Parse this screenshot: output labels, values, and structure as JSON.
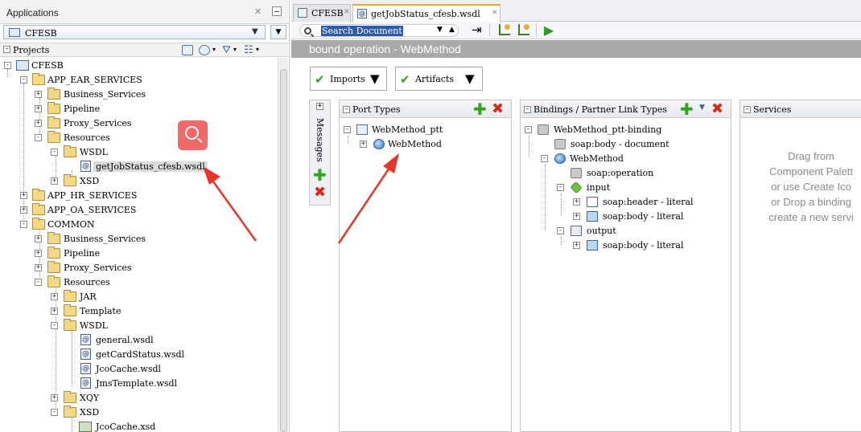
{
  "applications": {
    "title": "Applications",
    "selected_app": "CFESB",
    "projects_label": "Projects"
  },
  "tree": [
    {
      "label": "CFESB"
    },
    {
      "label": "APP_EAR_SERVICES"
    },
    {
      "label": "Business_Services"
    },
    {
      "label": "Pipeline"
    },
    {
      "label": "Proxy_Services"
    },
    {
      "label": "Resources"
    },
    {
      "label": "WSDL"
    },
    {
      "label": "getJobStatus_cfesb.wsdl"
    },
    {
      "label": "XSD"
    },
    {
      "label": "APP_HR_SERVICES"
    },
    {
      "label": "APP_OA_SERVICES"
    },
    {
      "label": "COMMON"
    },
    {
      "label": "Business_Services"
    },
    {
      "label": "Pipeline"
    },
    {
      "label": "Proxy_Services"
    },
    {
      "label": "Resources"
    },
    {
      "label": "JAR"
    },
    {
      "label": "Template"
    },
    {
      "label": "WSDL"
    },
    {
      "label": "general.wsdl"
    },
    {
      "label": "getCardStatus.wsdl"
    },
    {
      "label": "JcoCache.wsdl"
    },
    {
      "label": "JmsTemplate.wsdl"
    },
    {
      "label": "XQY"
    },
    {
      "label": "XSD"
    },
    {
      "label": "JcoCache.xsd"
    }
  ],
  "editor_tabs": [
    {
      "label": "CFESB"
    },
    {
      "label": "getJobStatus_cfesb.wsdl"
    }
  ],
  "search": {
    "text": "Search Document"
  },
  "ops_header": "bound operation - WebMethod",
  "buttons": {
    "imports": "Imports",
    "artifacts": "Artifacts"
  },
  "messages_label": "Messages",
  "port_types": {
    "title": "Port Types",
    "items": [
      "WebMethod_ptt",
      "WebMethod"
    ]
  },
  "bindings": {
    "title": "Bindings / Partner Link Types",
    "items": [
      "WebMethod_ptt-binding",
      "soap:body - document",
      "WebMethod",
      "soap:operation",
      "input",
      "soap:header - literal",
      "soap:body - literal",
      "output",
      "soap:body - literal"
    ]
  },
  "services": {
    "title": "Services",
    "drag_lines": [
      "Drag from",
      "Component Palett",
      "or use Create Ico",
      "or Drop a binding",
      "create a new servi"
    ]
  },
  "colors": {
    "accent": "#f2a735",
    "header_gray": "#a9a9a9",
    "add_green": "#32a520",
    "delete_red": "#d22b1b",
    "arrow_red": "#e8352a"
  }
}
